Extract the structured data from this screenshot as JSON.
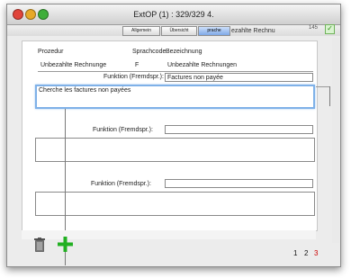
{
  "window": {
    "title": "ExtOP (1) : 329/329 4."
  },
  "badge": {
    "text": "145",
    "checkmark": "✓"
  },
  "tabs": [
    {
      "label": "Allgemein",
      "active": false
    },
    {
      "label": "Übersicht",
      "active": false
    },
    {
      "label": "prache",
      "active": true
    }
  ],
  "tab_overflow_text": "ezahlte Rechnu",
  "form": {
    "col_prozedur": "Prozedur",
    "col_sprachcode": "Sprachcode",
    "col_bezeichnung": "Bezeichnung",
    "row_prozedur_value": "Unbezahlte Rechnunge",
    "row_sprachcode_value": "F",
    "row_bezeichnung_value": "Unbezahlte Rechnungen",
    "funktion_label": "Funktion (Fremdspr.):",
    "funktion_value": "Factures non payée",
    "desc_value": "Cherche les factures non payées",
    "funktion2_label": "Funktion (Fremdspr.):",
    "funktion2_value": "",
    "funktion3_label": "Funktion (Fremdspr.):",
    "funktion3_value": ""
  },
  "pagination": {
    "p1": "1",
    "p2": "2",
    "p3": "3",
    "current": "3"
  },
  "icons": {
    "delete": "trash-icon",
    "add": "plus-icon"
  },
  "colors": {
    "active_tab": "#7fa8e6",
    "focus_ring": "#7fb1e8",
    "plus_green": "#22b022",
    "current_page": "#cc0000"
  }
}
